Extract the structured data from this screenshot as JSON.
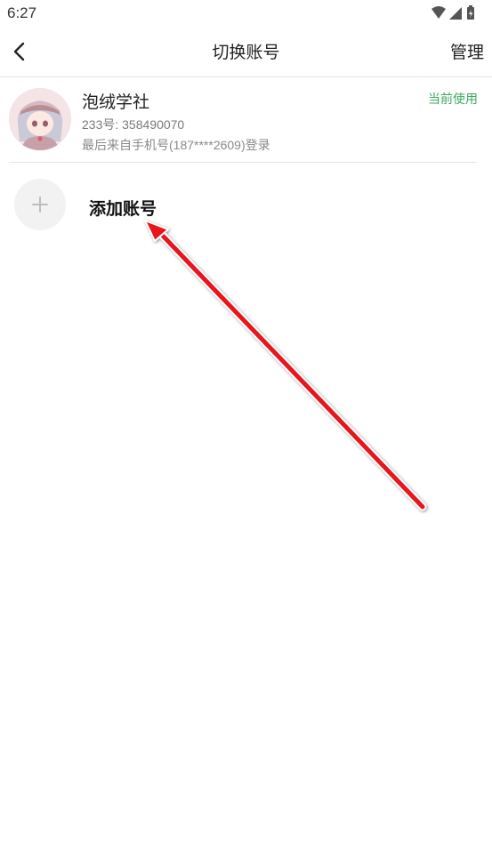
{
  "status_bar": {
    "time": "6:27",
    "icons": [
      "wifi-icon",
      "signal-icon",
      "battery-icon"
    ]
  },
  "nav": {
    "back_icon": "chevron-left-icon",
    "title": "切换账号",
    "manage_label": "管理"
  },
  "account": {
    "name": "泡绒学社",
    "id_text": "233号: 358490070",
    "login_text": "最后来自手机号(187****2609)登录",
    "badge": "当前使用",
    "badge_color": "#3aaa5c"
  },
  "add_account": {
    "icon": "plus-icon",
    "label": "添加账号"
  },
  "annotation": {
    "type": "arrow",
    "color": "#e8141b"
  }
}
